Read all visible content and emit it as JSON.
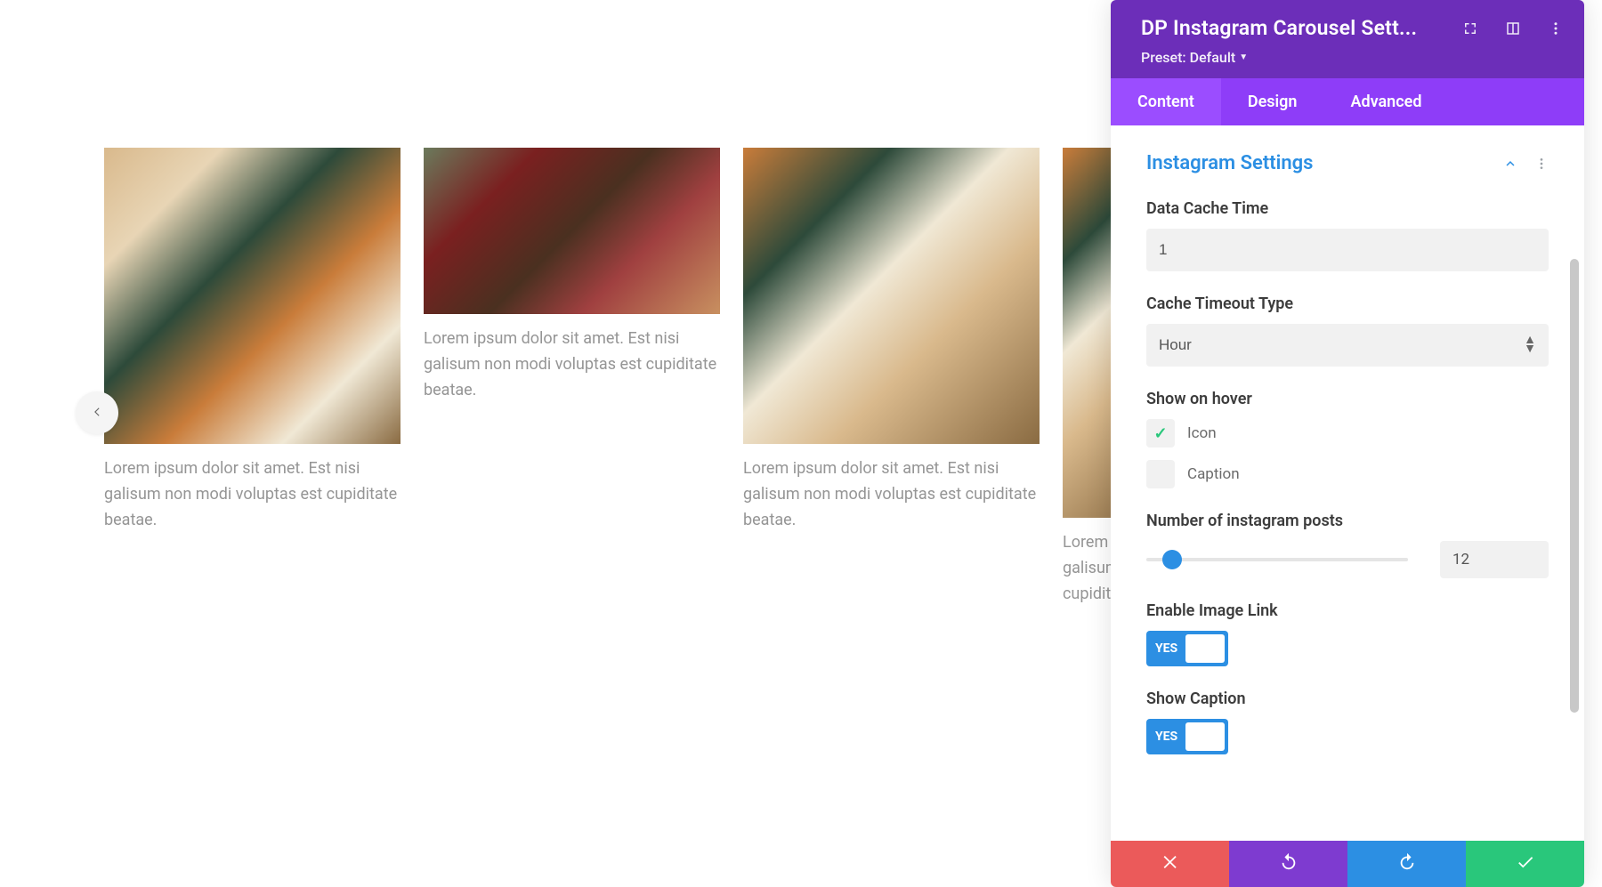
{
  "carousel": {
    "caption_text": "Lorem ipsum dolor sit amet. Est nisi galisum non modi voluptas est cupiditate beatae.",
    "partial_caption": "Lorem ips\ngalisum n\ncupiditate"
  },
  "panel": {
    "title": "DP Instagram Carousel Sett...",
    "preset_label": "Preset:",
    "preset_value": "Default",
    "tabs": {
      "content": "Content",
      "design": "Design",
      "advanced": "Advanced"
    },
    "section_title": "Instagram Settings",
    "fields": {
      "data_cache_time": {
        "label": "Data Cache Time",
        "value": "1"
      },
      "cache_timeout_type": {
        "label": "Cache Timeout Type",
        "value": "Hour"
      },
      "show_on_hover": {
        "label": "Show on hover",
        "icon_label": "Icon",
        "caption_label": "Caption"
      },
      "num_posts": {
        "label": "Number of instagram posts",
        "value": "12"
      },
      "enable_image_link": {
        "label": "Enable Image Link",
        "value": "YES"
      },
      "show_caption": {
        "label": "Show Caption",
        "value": "YES"
      }
    }
  }
}
